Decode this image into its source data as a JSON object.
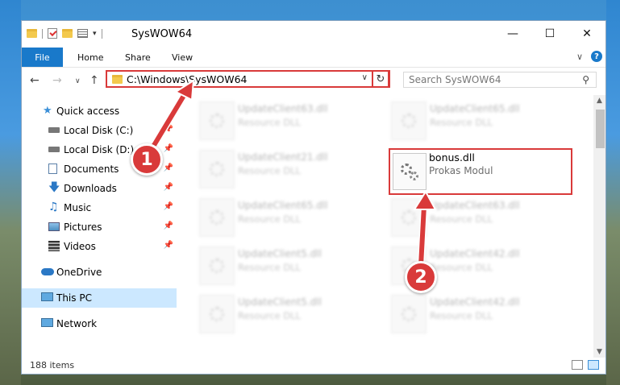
{
  "window": {
    "title": "SysWOW64"
  },
  "ribbon": {
    "file": "File",
    "home": "Home",
    "share": "Share",
    "view": "View",
    "help": "?"
  },
  "address": {
    "path": "C:\\Windows\\SysWOW64"
  },
  "search": {
    "placeholder": "Search SysWOW64"
  },
  "sidebar": {
    "items": [
      {
        "label": "Quick access",
        "icon": "star-icon"
      },
      {
        "label": "Local Disk (C:)",
        "icon": "drive-icon"
      },
      {
        "label": "Local Disk (D:)",
        "icon": "drive-icon"
      },
      {
        "label": "Documents",
        "icon": "documents-icon"
      },
      {
        "label": "Downloads",
        "icon": "download-icon"
      },
      {
        "label": "Music",
        "icon": "music-icon"
      },
      {
        "label": "Pictures",
        "icon": "pictures-icon"
      },
      {
        "label": "Videos",
        "icon": "videos-icon"
      },
      {
        "label": "OneDrive",
        "icon": "cloud-icon"
      },
      {
        "label": "This PC",
        "icon": "computer-icon",
        "selected": true
      },
      {
        "label": "Network",
        "icon": "network-icon"
      }
    ]
  },
  "files": {
    "left": [
      {
        "name": "UpdateClient63.dll",
        "desc": "Resource DLL"
      },
      {
        "name": "UpdateClient21.dll",
        "desc": "Resource DLL"
      },
      {
        "name": "UpdateClient65.dll",
        "desc": "Resource DLL"
      },
      {
        "name": "UpdateClient5.dll",
        "desc": "Resource DLL"
      },
      {
        "name": "UpdateClient5.dll",
        "desc": "Resource DLL"
      }
    ],
    "right": [
      {
        "name": "UpdateClient65.dll",
        "desc": "Resource DLL"
      },
      {
        "name": "UpdateClient63.dll",
        "desc": "Resource DLL"
      },
      {
        "name": "UpdateClient42.dll",
        "desc": "Resource DLL"
      },
      {
        "name": "UpdateClient42.dll",
        "desc": "Resource DLL"
      }
    ],
    "highlighted": {
      "name": "bonus.dll",
      "desc": "Prokas Modul"
    }
  },
  "status": {
    "count": "188 items"
  },
  "callouts": {
    "one": "1",
    "two": "2"
  },
  "colors": {
    "accent": "#1979ca",
    "highlight": "#d93a3a",
    "selection": "#cce8ff"
  }
}
